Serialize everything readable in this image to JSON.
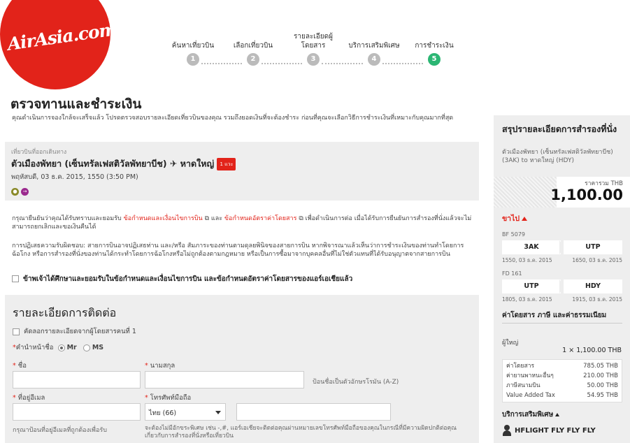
{
  "brand": {
    "logo_text": "AirAsia.com",
    "color": "#e2231a",
    "step_active_color": "#2bb673"
  },
  "steps": [
    {
      "label": "ค้นหาเที่ยวบิน",
      "num": "1"
    },
    {
      "label": "เลือกเที่ยวบิน",
      "num": "2"
    },
    {
      "label": "รายละเอียดผู้โดยสาร",
      "num": "3"
    },
    {
      "label": "บริการเสริมพิเศษ",
      "num": "4"
    },
    {
      "label": "การชำระเงิน",
      "num": "5"
    }
  ],
  "page": {
    "title": "ตรวจทานและชำระเงิน",
    "intro": "คุณดำเนินการจองใกล้จะเสร็จแล้ว โปรดตรวจสอบรายละเอียดเที่ยวบินของคุณ รวมถึงยอดเงินที่จะต้องชำระ ก่อนที่คุณจะเลือกวิธีการชำระเงินที่เหมาะกับคุณมากที่สุด"
  },
  "flight": {
    "kicker": "เที่ยวบินที่ออกเดินทาง",
    "route": "ตัวเมืองพัทยา (เซ็นทรัลเฟสติวัลพัทยาบีช) ✈ หาดใหญ่",
    "stops_badge": "1 แวะ",
    "date": "พฤหัสบดี, 03 ธ.ค. 2015, 1550 (3:50 PM)"
  },
  "terms": {
    "pre": "กรุณายืนยันว่าคุณได้รับทราบและยอมรับ",
    "link1": "ข้อกำหนดและเงื่อนไขการบิน",
    "mid": " และ ",
    "link2": "ข้อกำหนดอัตราค่าโดยสาร",
    "post": " เพื่อดำเนินการต่อ เมื่อได้รับการยืนยันการสำรองที่นั่งแล้วจะไม่สามารถยกเลิกและขอเงินคืนได้",
    "disclaimer": "การปฏิเสธความรับผิดชอบ: สายการบินอาจปฏิเสธท่าน และ/หรือ สัมภาระของท่านตามดุลยพินิจของสายการบิน หากพิจารณาแล้วเห็นว่าการชำระเงินของท่านทำโดยการฉ้อโกง หรือการสำรองที่นั่งของท่านได้กระทำโดยการฉ้อโกงหรือไม่ถูกต้องตามกฎหมาย หรือเป็นการซื้อมาจากบุคคลอื่นที่ไม่ใช่ตัวแทนที่ได้รับอนุญาตจากสายการบิน",
    "agree": "ข้าพเจ้าได้ศึกษาและยอมรับในข้อกำหนดและเงื่อนไขการบิน และข้อกำหนดอัตราค่าโดยสารของแอร์เอเชียแล้ว"
  },
  "contact": {
    "title": "รายละเอียดการติดต่อ",
    "copy_label": "คัดลอกรายละเอียดจากผู้โดยสารคนที่ 1",
    "title_label": "คำนำหน้าชื่อ",
    "mr": "Mr",
    "ms": "MS",
    "first_name": "ชื่อ",
    "last_name": "นามสกุล",
    "name_hint": "ป้อนชื่อเป็นตัวอักษรโรมัน (A-Z)",
    "email": "ที่อยู่อีเมล",
    "mobile": "โทรศัพท์มือถือ",
    "country_code": "ไทย (66)",
    "email_hint": "กรุณาป้อนที่อยู่อีเมลที่ถูกต้องเพื่อรับ",
    "mobile_hint": "จะต้องไม่มีอักขระพิเศษ เช่น -,#, แอร์เอเชียจะติดต่อคุณผ่านหมายเลขโทรศัพท์มือถือของคุณในกรณีที่มีความผิดปกติต่อคุณเกี่ยวกับการสำรองที่นั่งหรือเที่ยวบิน"
  },
  "summary": {
    "title": "สรุปรายละเอียดการสำรองที่นั่ง",
    "route": "ตัวเมืองพัทยา (เซ็นทรัลเฟสติวัลพัทยาบีช) (3AK) to หาดใหญ่ (HDY)",
    "total_label": "ราคารวม THB",
    "total": "1,100.00",
    "outbound": "ขาไป",
    "legs": [
      {
        "flight": "BF 5079",
        "from": "3AK",
        "to": "UTP",
        "dep": "1550, 03 ธ.ค. 2015",
        "arr": "1650, 03 ธ.ค. 2015"
      },
      {
        "flight": "FD 161",
        "from": "UTP",
        "to": "HDY",
        "dep": "1805, 03 ธ.ค. 2015",
        "arr": "1915, 03 ธ.ค. 2015"
      }
    ],
    "fees_title": "ค่าโดยสาร ภาษี และค่าธรรมเนียม",
    "adult_label": "ผู้ใหญ่",
    "adult_line": "1 × 1,100.00 THB",
    "fees": [
      {
        "name": "ค่าโดยสาร",
        "amount": "785.05 THB"
      },
      {
        "name": "ค่ายานพาหนะอื่นๆ",
        "amount": "210.00 THB"
      },
      {
        "name": "ภาษีสนามบิน",
        "amount": "50.00 THB"
      },
      {
        "name": "Value Added Tax",
        "amount": "54.95 THB"
      }
    ],
    "extras_title": "บริการเสริมพิเศษ",
    "passenger": "HFLIGHT FLY FLY FLY"
  }
}
